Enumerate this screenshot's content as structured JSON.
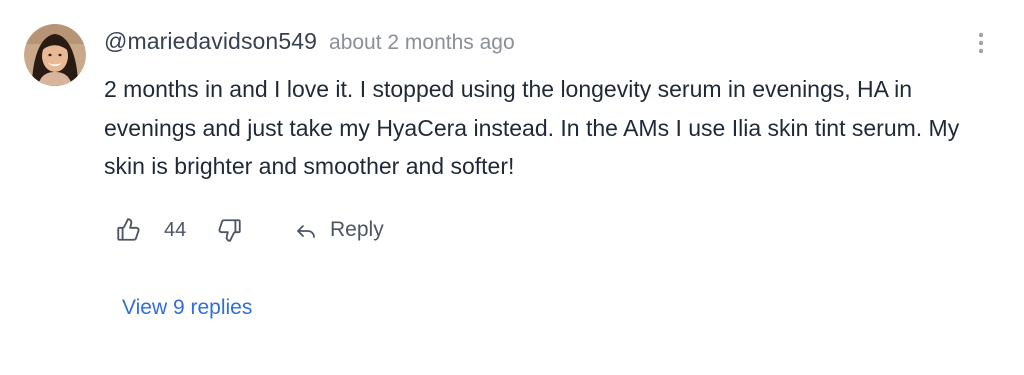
{
  "comment": {
    "username": "@mariedavidson549",
    "timestamp": "about 2 months ago",
    "body": "2 months in and I love it. I stopped using the longevity serum in evenings, HA in evenings and just take my HyaCera instead. In the AMs I use Ilia skin tint serum. My skin is brighter and smoother and softer!",
    "like_count": "44",
    "reply_label": "Reply",
    "view_replies_label": "View 9 replies"
  },
  "icons": {
    "avatar": "user-avatar-photo",
    "more": "more-vertical-icon",
    "like": "thumbs-up-icon",
    "dislike": "thumbs-down-icon",
    "reply": "reply-arrow-icon"
  },
  "colors": {
    "text": "#1f2937",
    "muted": "#8a8f98",
    "link": "#2f6fdc"
  }
}
